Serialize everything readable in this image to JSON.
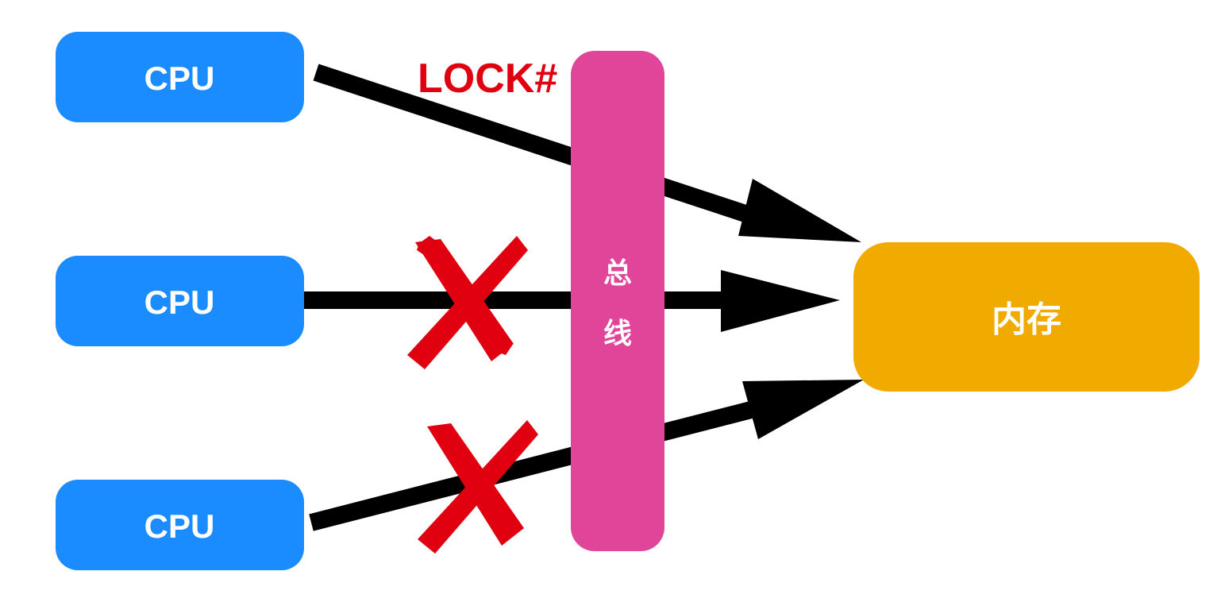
{
  "cpu_nodes": [
    {
      "label": "CPU",
      "status": "locked-owner"
    },
    {
      "label": "CPU",
      "status": "blocked"
    },
    {
      "label": "CPU",
      "status": "blocked"
    }
  ],
  "bus": {
    "label_line1": "总",
    "label_line2": "线"
  },
  "memory": {
    "label": "内存"
  },
  "lock_signal": {
    "label": "LOCK#"
  },
  "colors": {
    "cpu": "#1a8cff",
    "bus": "#e0459a",
    "memory": "#f0aa00",
    "arrow": "#000000",
    "lock_text": "#e00010",
    "cross": "#e00010"
  },
  "icons": [
    "arrow-icon",
    "cross-icon"
  ]
}
